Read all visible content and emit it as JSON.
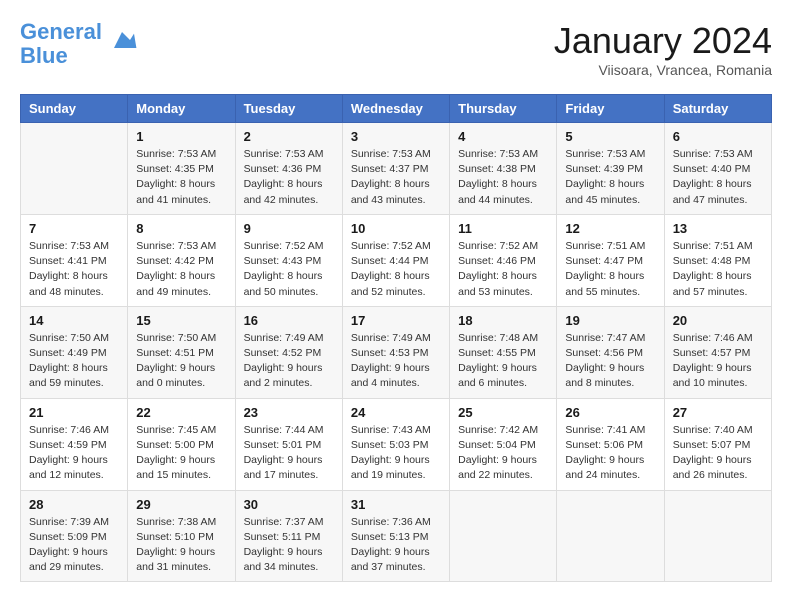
{
  "header": {
    "logo_line1": "General",
    "logo_line2": "Blue",
    "month_title": "January 2024",
    "location": "Viisoara, Vrancea, Romania"
  },
  "weekdays": [
    "Sunday",
    "Monday",
    "Tuesday",
    "Wednesday",
    "Thursday",
    "Friday",
    "Saturday"
  ],
  "weeks": [
    [
      {
        "day": "",
        "sunrise": "",
        "sunset": "",
        "daylight": ""
      },
      {
        "day": "1",
        "sunrise": "Sunrise: 7:53 AM",
        "sunset": "Sunset: 4:35 PM",
        "daylight": "Daylight: 8 hours and 41 minutes."
      },
      {
        "day": "2",
        "sunrise": "Sunrise: 7:53 AM",
        "sunset": "Sunset: 4:36 PM",
        "daylight": "Daylight: 8 hours and 42 minutes."
      },
      {
        "day": "3",
        "sunrise": "Sunrise: 7:53 AM",
        "sunset": "Sunset: 4:37 PM",
        "daylight": "Daylight: 8 hours and 43 minutes."
      },
      {
        "day": "4",
        "sunrise": "Sunrise: 7:53 AM",
        "sunset": "Sunset: 4:38 PM",
        "daylight": "Daylight: 8 hours and 44 minutes."
      },
      {
        "day": "5",
        "sunrise": "Sunrise: 7:53 AM",
        "sunset": "Sunset: 4:39 PM",
        "daylight": "Daylight: 8 hours and 45 minutes."
      },
      {
        "day": "6",
        "sunrise": "Sunrise: 7:53 AM",
        "sunset": "Sunset: 4:40 PM",
        "daylight": "Daylight: 8 hours and 47 minutes."
      }
    ],
    [
      {
        "day": "7",
        "sunrise": "Sunrise: 7:53 AM",
        "sunset": "Sunset: 4:41 PM",
        "daylight": "Daylight: 8 hours and 48 minutes."
      },
      {
        "day": "8",
        "sunrise": "Sunrise: 7:53 AM",
        "sunset": "Sunset: 4:42 PM",
        "daylight": "Daylight: 8 hours and 49 minutes."
      },
      {
        "day": "9",
        "sunrise": "Sunrise: 7:52 AM",
        "sunset": "Sunset: 4:43 PM",
        "daylight": "Daylight: 8 hours and 50 minutes."
      },
      {
        "day": "10",
        "sunrise": "Sunrise: 7:52 AM",
        "sunset": "Sunset: 4:44 PM",
        "daylight": "Daylight: 8 hours and 52 minutes."
      },
      {
        "day": "11",
        "sunrise": "Sunrise: 7:52 AM",
        "sunset": "Sunset: 4:46 PM",
        "daylight": "Daylight: 8 hours and 53 minutes."
      },
      {
        "day": "12",
        "sunrise": "Sunrise: 7:51 AM",
        "sunset": "Sunset: 4:47 PM",
        "daylight": "Daylight: 8 hours and 55 minutes."
      },
      {
        "day": "13",
        "sunrise": "Sunrise: 7:51 AM",
        "sunset": "Sunset: 4:48 PM",
        "daylight": "Daylight: 8 hours and 57 minutes."
      }
    ],
    [
      {
        "day": "14",
        "sunrise": "Sunrise: 7:50 AM",
        "sunset": "Sunset: 4:49 PM",
        "daylight": "Daylight: 8 hours and 59 minutes."
      },
      {
        "day": "15",
        "sunrise": "Sunrise: 7:50 AM",
        "sunset": "Sunset: 4:51 PM",
        "daylight": "Daylight: 9 hours and 0 minutes."
      },
      {
        "day": "16",
        "sunrise": "Sunrise: 7:49 AM",
        "sunset": "Sunset: 4:52 PM",
        "daylight": "Daylight: 9 hours and 2 minutes."
      },
      {
        "day": "17",
        "sunrise": "Sunrise: 7:49 AM",
        "sunset": "Sunset: 4:53 PM",
        "daylight": "Daylight: 9 hours and 4 minutes."
      },
      {
        "day": "18",
        "sunrise": "Sunrise: 7:48 AM",
        "sunset": "Sunset: 4:55 PM",
        "daylight": "Daylight: 9 hours and 6 minutes."
      },
      {
        "day": "19",
        "sunrise": "Sunrise: 7:47 AM",
        "sunset": "Sunset: 4:56 PM",
        "daylight": "Daylight: 9 hours and 8 minutes."
      },
      {
        "day": "20",
        "sunrise": "Sunrise: 7:46 AM",
        "sunset": "Sunset: 4:57 PM",
        "daylight": "Daylight: 9 hours and 10 minutes."
      }
    ],
    [
      {
        "day": "21",
        "sunrise": "Sunrise: 7:46 AM",
        "sunset": "Sunset: 4:59 PM",
        "daylight": "Daylight: 9 hours and 12 minutes."
      },
      {
        "day": "22",
        "sunrise": "Sunrise: 7:45 AM",
        "sunset": "Sunset: 5:00 PM",
        "daylight": "Daylight: 9 hours and 15 minutes."
      },
      {
        "day": "23",
        "sunrise": "Sunrise: 7:44 AM",
        "sunset": "Sunset: 5:01 PM",
        "daylight": "Daylight: 9 hours and 17 minutes."
      },
      {
        "day": "24",
        "sunrise": "Sunrise: 7:43 AM",
        "sunset": "Sunset: 5:03 PM",
        "daylight": "Daylight: 9 hours and 19 minutes."
      },
      {
        "day": "25",
        "sunrise": "Sunrise: 7:42 AM",
        "sunset": "Sunset: 5:04 PM",
        "daylight": "Daylight: 9 hours and 22 minutes."
      },
      {
        "day": "26",
        "sunrise": "Sunrise: 7:41 AM",
        "sunset": "Sunset: 5:06 PM",
        "daylight": "Daylight: 9 hours and 24 minutes."
      },
      {
        "day": "27",
        "sunrise": "Sunrise: 7:40 AM",
        "sunset": "Sunset: 5:07 PM",
        "daylight": "Daylight: 9 hours and 26 minutes."
      }
    ],
    [
      {
        "day": "28",
        "sunrise": "Sunrise: 7:39 AM",
        "sunset": "Sunset: 5:09 PM",
        "daylight": "Daylight: 9 hours and 29 minutes."
      },
      {
        "day": "29",
        "sunrise": "Sunrise: 7:38 AM",
        "sunset": "Sunset: 5:10 PM",
        "daylight": "Daylight: 9 hours and 31 minutes."
      },
      {
        "day": "30",
        "sunrise": "Sunrise: 7:37 AM",
        "sunset": "Sunset: 5:11 PM",
        "daylight": "Daylight: 9 hours and 34 minutes."
      },
      {
        "day": "31",
        "sunrise": "Sunrise: 7:36 AM",
        "sunset": "Sunset: 5:13 PM",
        "daylight": "Daylight: 9 hours and 37 minutes."
      },
      {
        "day": "",
        "sunrise": "",
        "sunset": "",
        "daylight": ""
      },
      {
        "day": "",
        "sunrise": "",
        "sunset": "",
        "daylight": ""
      },
      {
        "day": "",
        "sunrise": "",
        "sunset": "",
        "daylight": ""
      }
    ]
  ]
}
